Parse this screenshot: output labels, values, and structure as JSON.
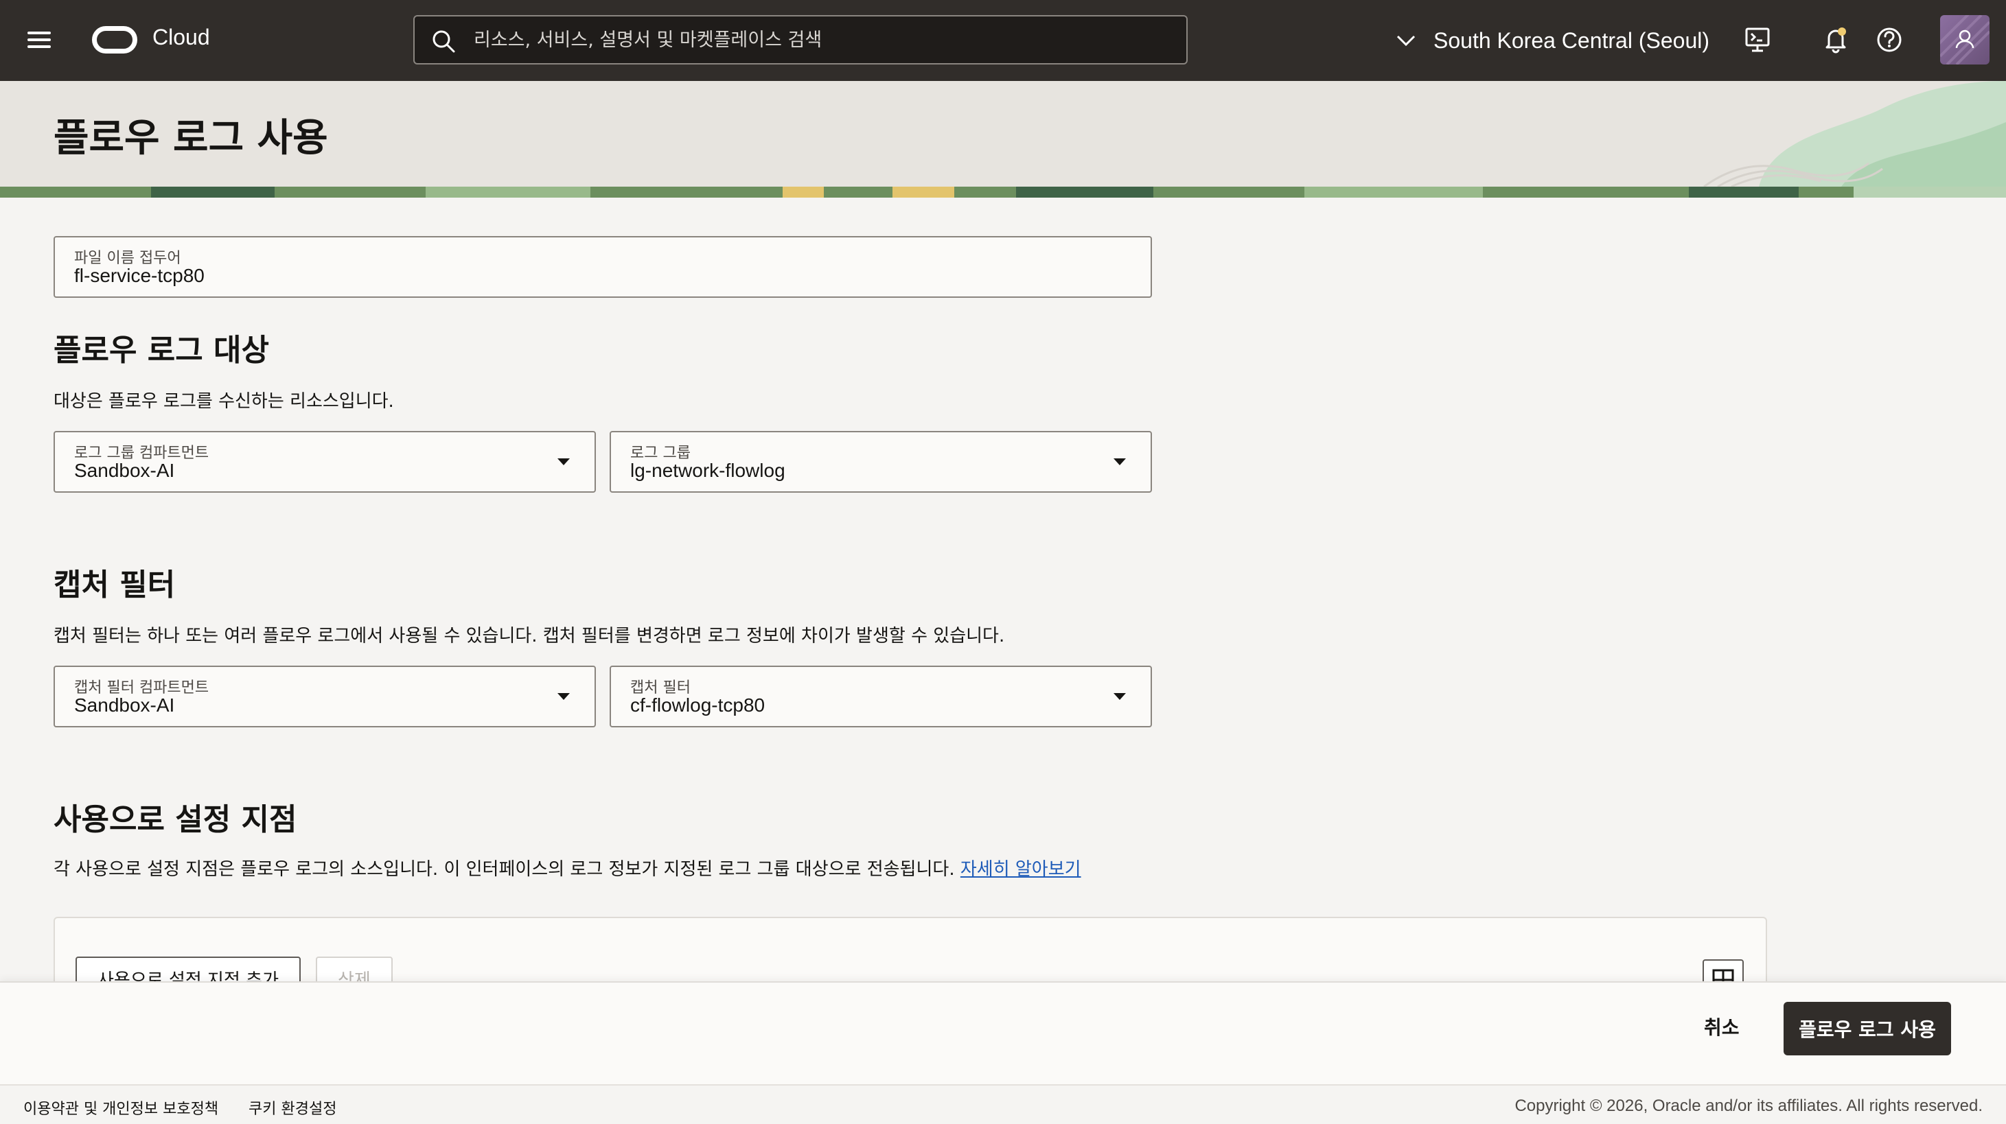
{
  "topbar": {
    "brand": "Cloud",
    "search_placeholder": "리소스, 서비스, 설명서 및 마켓플레이스 검색",
    "region": "South Korea Central (Seoul)"
  },
  "page": {
    "title": "플로우 로그 사용"
  },
  "file_prefix": {
    "label": "파일 이름 접두어",
    "value": "fl-service-tcp80"
  },
  "destination": {
    "title": "플로우 로그 대상",
    "description": "대상은 플로우 로그를 수신하는 리소스입니다.",
    "compartment_label": "로그 그룹 컴파트먼트",
    "compartment_value": "Sandbox-AI",
    "log_group_label": "로그 그룹",
    "log_group_value": "lg-network-flowlog"
  },
  "capture_filter": {
    "title": "캡처 필터",
    "description": "캡처 필터는 하나 또는 여러 플로우 로그에서 사용될 수 있습니다. 캡처 필터를 변경하면 로그 정보에 차이가 발생할 수 있습니다.",
    "compartment_label": "캡처 필터 컴파트먼트",
    "compartment_value": "Sandbox-AI",
    "filter_label": "캡처 필터",
    "filter_value": "cf-flowlog-tcp80"
  },
  "enablement_points": {
    "title": "사용으로 설정 지점",
    "description": "각 사용으로 설정 지점은 플로우 로그의 소스입니다. 이 인터페이스의 로그 정보가 지정된 로그 그룹 대상으로 전송됩니다.",
    "learn_more": "자세히 알아보기",
    "add_button": "사용으로 설정 지점 추가",
    "delete_button": "삭제"
  },
  "actions": {
    "cancel": "취소",
    "submit": "플로우 로그 사용"
  },
  "footer": {
    "terms": "이용약관 및 개인정보 보호정책",
    "cookies": "쿠키 환경설정",
    "copyright": "Copyright © 2026, Oracle and/or its affiliates. All rights reserved."
  }
}
